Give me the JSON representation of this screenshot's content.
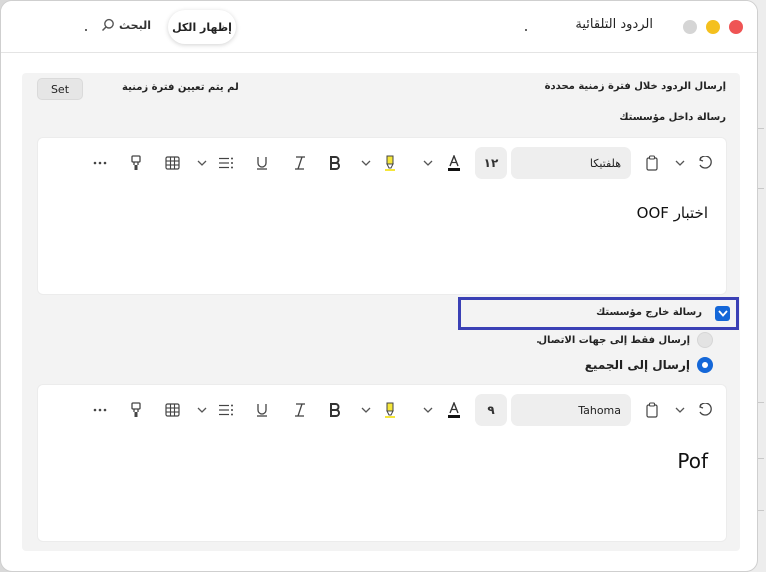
{
  "window": {
    "title": "الردود التلقائية",
    "show_all_label": "إظهار الكل",
    "search_label": "البحث",
    "search_icon": "search-icon"
  },
  "period": {
    "send_label": "إرسال الردود خلال فترة زمنية محددة",
    "status": "لم يتم تعيين فترة زمنية",
    "set_button": "Set"
  },
  "inside": {
    "label": "رسالة داخل مؤسستك",
    "toolbar": {
      "font": "هلفتيكا",
      "size": "١٢"
    },
    "body_text": "اختبار OOF"
  },
  "outside": {
    "label": "رسالة خارج مؤسستك",
    "checked": true,
    "options": [
      {
        "label": "إرسال فقط إلى جهات الاتصال",
        "selected": false
      },
      {
        "label": "إرسال إلى الجميع",
        "selected": true
      }
    ],
    "toolbar": {
      "font": "Tahoma",
      "size": "٩"
    },
    "body_text": "Pof"
  },
  "colors": {
    "accent": "#1467d8",
    "highlight_outline": "#3a40b5",
    "close": "#ef5454",
    "minimize": "#f4c01e",
    "maximize": "#d5d5d5",
    "highlighter": "#f5e63a"
  }
}
